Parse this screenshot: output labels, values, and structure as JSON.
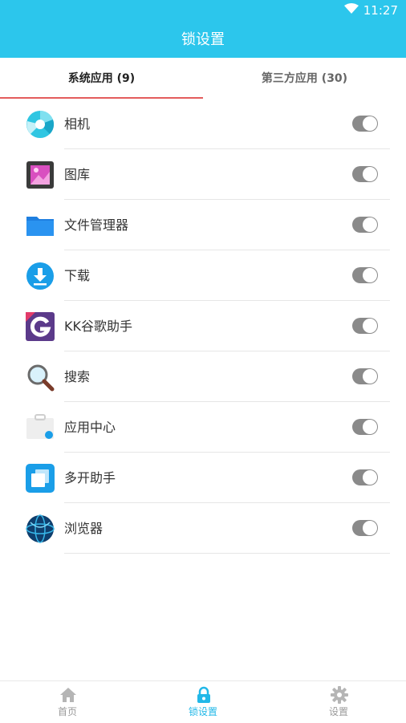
{
  "status_bar": {
    "time": "11:27"
  },
  "app_bar": {
    "title": "锁设置"
  },
  "tabs": [
    {
      "label": "系统应用 (9)"
    },
    {
      "label": "第三方应用 (30)"
    }
  ],
  "apps": [
    {
      "name": "相机",
      "icon": "camera-icon",
      "locked": true
    },
    {
      "name": "图库",
      "icon": "gallery-icon",
      "locked": true
    },
    {
      "name": "文件管理器",
      "icon": "folder-icon",
      "locked": true
    },
    {
      "name": "下载",
      "icon": "download-icon",
      "locked": true
    },
    {
      "name": "KK谷歌助手",
      "icon": "google-assistant-icon",
      "locked": true
    },
    {
      "name": "搜索",
      "icon": "magnifier-icon",
      "locked": true
    },
    {
      "name": "应用中心",
      "icon": "app-center-icon",
      "locked": true
    },
    {
      "name": "多开助手",
      "icon": "multi-window-icon",
      "locked": true
    },
    {
      "name": "浏览器",
      "icon": "globe-icon",
      "locked": true
    }
  ],
  "bottom_nav": [
    {
      "label": "首页",
      "icon": "home-icon"
    },
    {
      "label": "锁设置",
      "icon": "lock-icon"
    },
    {
      "label": "设置",
      "icon": "gear-icon"
    }
  ],
  "colors": {
    "primary": "#2cc6ec",
    "tab_indicator": "#e35c5c",
    "toggle_track": "#8a8a8a",
    "nav_active": "#22b8e8"
  }
}
